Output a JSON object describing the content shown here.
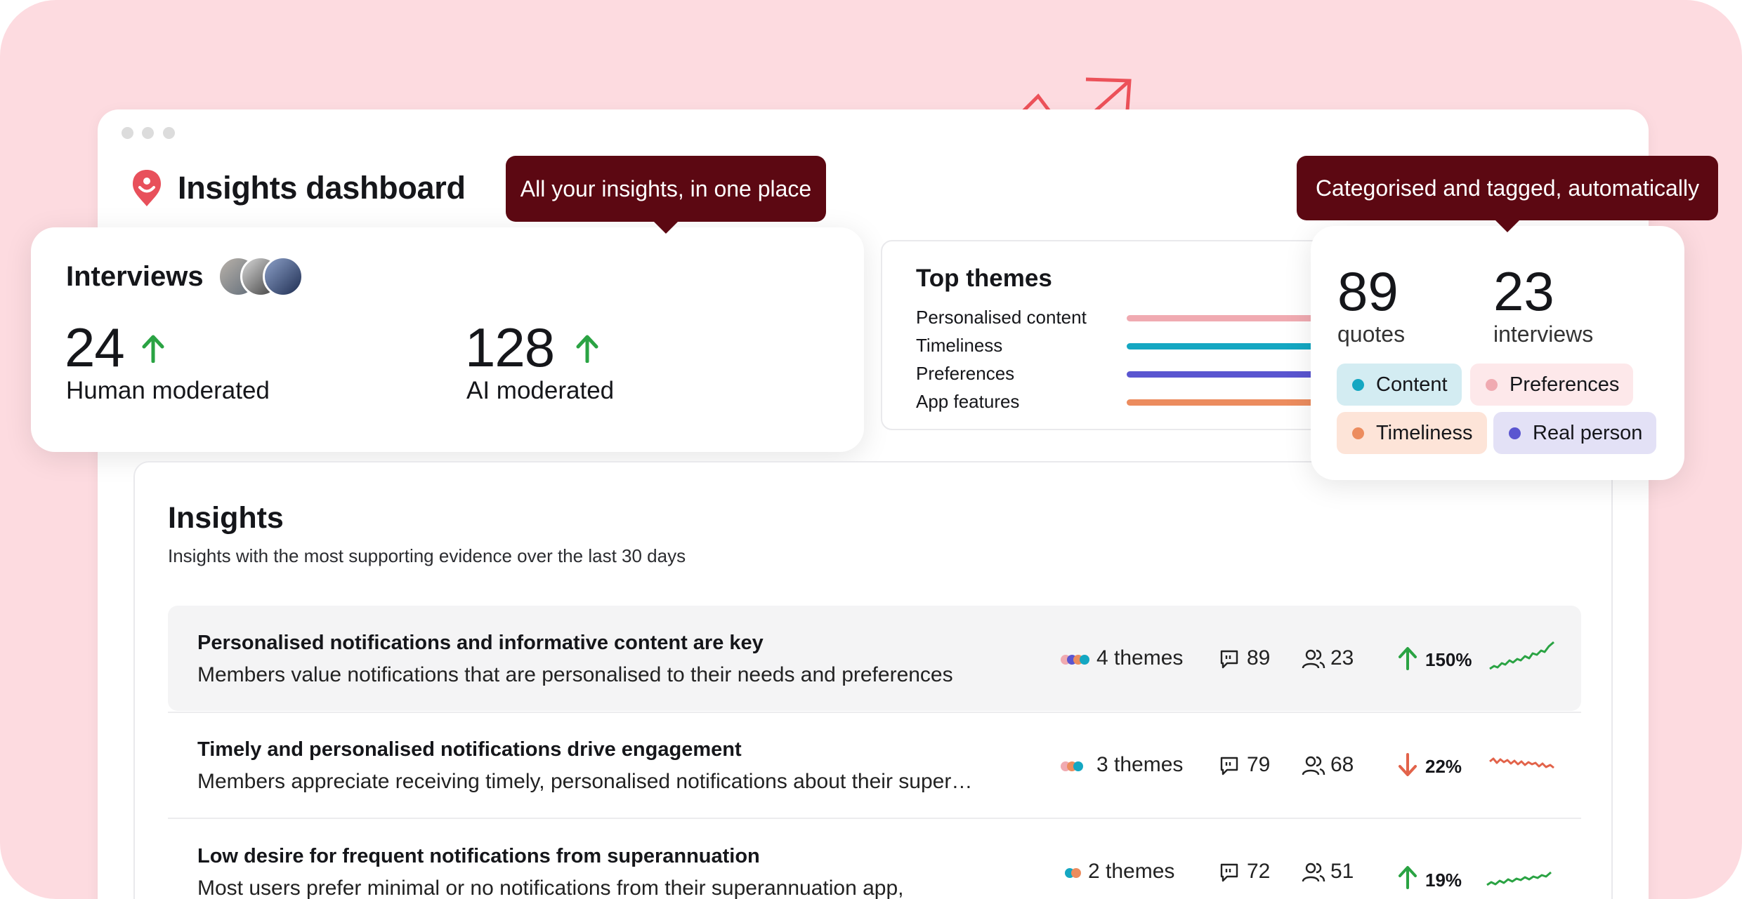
{
  "dashboard": {
    "title": "Insights dashboard"
  },
  "tooltips": {
    "left": "All your insights, in one place",
    "right": "Categorised and tagged, automatically"
  },
  "interviews": {
    "title": "Interviews",
    "human": {
      "value": "24",
      "label": "Human moderated"
    },
    "ai": {
      "value": "128",
      "label": "AI moderated"
    }
  },
  "top_themes": {
    "title": "Top themes",
    "items": [
      {
        "label": "Personalised content",
        "color": "#f0aab1"
      },
      {
        "label": "Timeliness",
        "color": "#14a7c2"
      },
      {
        "label": "Preferences",
        "color": "#5a55d0"
      },
      {
        "label": "App features",
        "color": "#ec8c5e"
      }
    ]
  },
  "stats": {
    "quotes": {
      "value": "89",
      "label": "quotes"
    },
    "interviews": {
      "value": "23",
      "label": "interviews"
    },
    "tags": [
      {
        "label": "Content",
        "bg": "#d3ecf2",
        "dot": "#14a7c2"
      },
      {
        "label": "Preferences",
        "bg": "#fde8ea",
        "dot": "#f0aab1"
      },
      {
        "label": "Timeliness",
        "bg": "#fde4d8",
        "dot": "#ec8c5e"
      },
      {
        "label": "Real person",
        "bg": "#e3e1f6",
        "dot": "#5a55d0"
      }
    ]
  },
  "insights": {
    "title": "Insights",
    "description": "Insights with the most supporting evidence over the last 30 days",
    "rows": [
      {
        "title": "Personalised notifications and informative content are key",
        "description": "Members value notifications that are personalised to their needs and preferences",
        "themes": "4 themes",
        "quotes": "89",
        "people": "23",
        "change": "150%",
        "direction": "up"
      },
      {
        "title": "Timely and personalised notifications drive engagement",
        "description": "Members appreciate receiving timely, personalised notifications about their super…",
        "themes": "3 themes",
        "quotes": "79",
        "people": "68",
        "change": "22%",
        "direction": "down"
      },
      {
        "title": "Low desire for frequent notifications from superannuation",
        "description": "Most users prefer minimal or no notifications from their superannuation app,",
        "themes": "2 themes",
        "quotes": "72",
        "people": "51",
        "change": "19%",
        "direction": "up"
      }
    ]
  },
  "colors": {
    "accent": "#e8505b",
    "tooltip_bg": "#5c0812",
    "up": "#2aa343",
    "down": "#e2634a"
  }
}
